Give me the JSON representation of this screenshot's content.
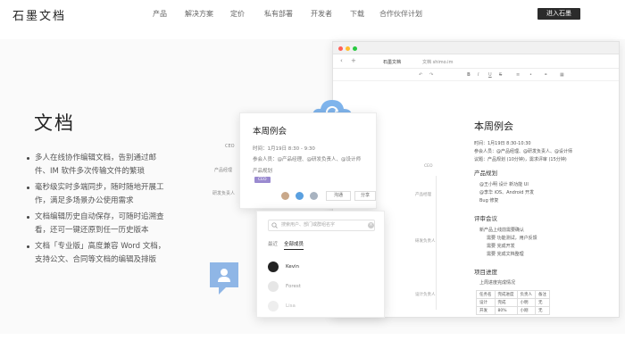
{
  "brand": {
    "logo": "石墨文档"
  },
  "nav": {
    "items": [
      "产品",
      "解决方案",
      "定价",
      "私有部署",
      "开发者",
      "下载",
      "合作伙伴计划"
    ],
    "enter": "进入石墨"
  },
  "hero": {
    "title": "文档",
    "features": [
      "多人在线协作编辑文档，告别通过邮件、IM 软件多次传输文件的繁琐",
      "毫秒级实时多端同步，随时随地开展工作，满足多场景办公使用需求",
      "文档编辑历史自动保存，可随时追溯查看，还可一键还原到任一历史版本",
      "文档「专业版」高度兼容 Word 文档，支持公文、合同等文档的编辑及排版"
    ]
  },
  "card": {
    "title": "本周例会",
    "time": "时间：1月19日 8:30 - 9:30",
    "attendees": "参会人员：@产品经理、@研发负责人、@设计师",
    "section": "产品规划",
    "tag": "CEO",
    "btn_one": "沟通",
    "btn_two": "分享"
  },
  "left_labels": {
    "one": "CEO",
    "two": "产品经理",
    "three": "研发负责人"
  },
  "popup": {
    "search_placeholder": "搜索用户、部门或群组名字",
    "tab_recent": "最近",
    "tab_all": "全部成员",
    "users": [
      "Kevin",
      "Forest",
      "Lisa"
    ]
  },
  "browser": {
    "tab": "石墨文档",
    "url_hint": "文档 shimo.im",
    "doc_title": "本周例会",
    "doc_time": "时间：1月19日 8:30-10:30",
    "doc_attendees": "参会人员：@产品经理、@研发负责人、@设计师",
    "doc_topic": "议题：产品规划 (10分钟)，需求评审 (15分钟)",
    "section_plan": "产品规划",
    "plan_items": [
      "@王小明 设计 新功能 UI",
      "@李华 iOS、Android 开发",
      "Bug 修复"
    ],
    "section_review": "评审会议",
    "review_intro": "新产品上线前需要确认",
    "review_items": [
      "需要 功能测试，用户反馈",
      "需要 完成开发",
      "需要 完成文档整理"
    ],
    "section_progress": "项目进度",
    "progress_intro": "上周进度完成情况",
    "table_headers": [
      "任务名",
      "完成进度",
      "负责人",
      "备注"
    ],
    "table_rows": [
      [
        "设计",
        "完成",
        "小明",
        "无"
      ],
      [
        "开发",
        "80%",
        "小刚",
        "无"
      ]
    ],
    "side_labels": [
      "CEO",
      "产品经理",
      "研发负责人",
      "设计负责人"
    ]
  }
}
